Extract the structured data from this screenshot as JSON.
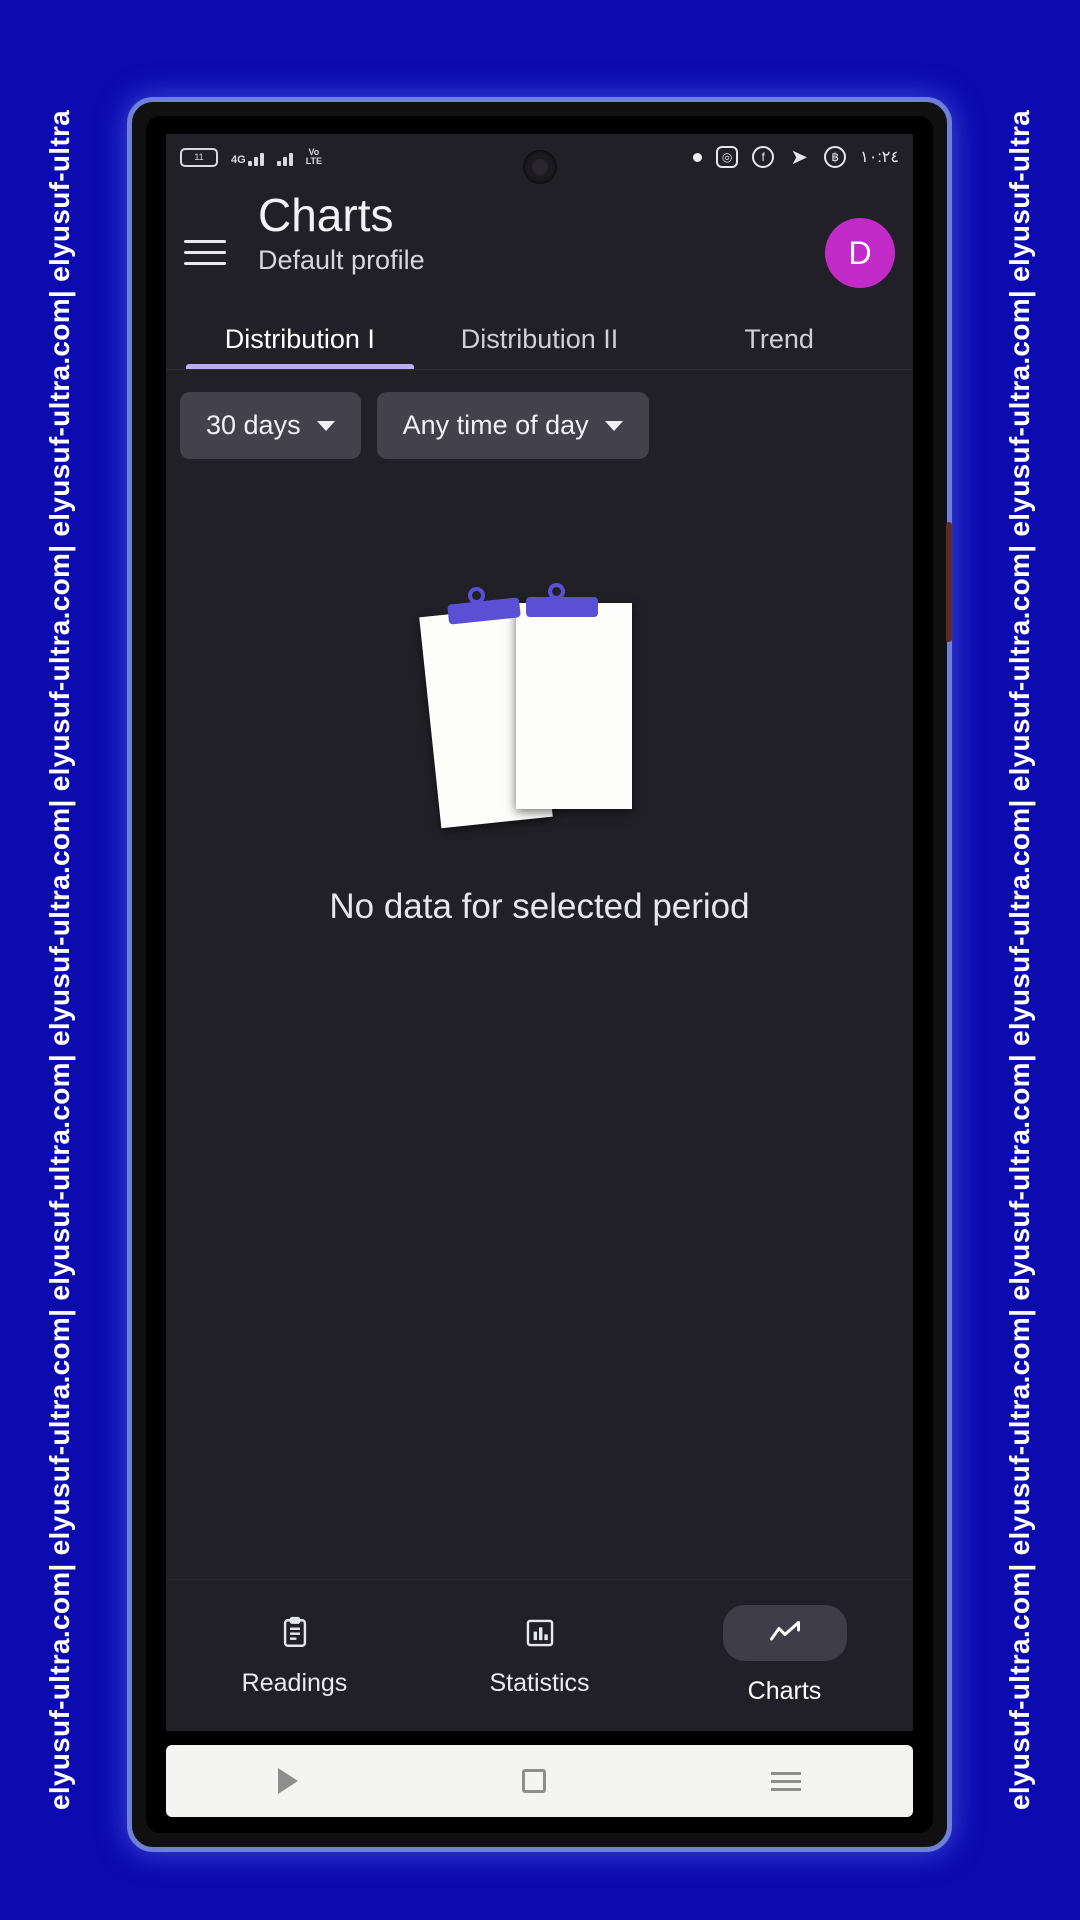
{
  "watermark": {
    "text": "elyusuf-ultra.com| elyusuf-ultra.com| elyusuf-ultra.com| elyusuf-ultra.com| elyusuf-ultra.com| elyusuf-ultra.com| elyusuf-ultra"
  },
  "statusbar": {
    "battery_label": "11",
    "network_label": "4G",
    "volte_top": "Vo",
    "volte_bottom": "LTE",
    "instagram_icon": "instagram-icon",
    "facebook_icon": "facebook-icon",
    "telegram_icon": "telegram-icon",
    "bitcoin_icon": "bitcoin-icon",
    "clock": "١٠:٢٤"
  },
  "appbar": {
    "menu_icon": "hamburger-menu-icon",
    "title": "Charts",
    "subtitle": "Default profile",
    "avatar_initial": "D"
  },
  "tabs": [
    {
      "label": "Distribution I",
      "active": true
    },
    {
      "label": "Distribution II",
      "active": false
    },
    {
      "label": "Trend",
      "active": false
    }
  ],
  "filters": [
    {
      "label": "30 days",
      "icon": "chevron-down-icon"
    },
    {
      "label": "Any time of day",
      "icon": "chevron-down-icon"
    }
  ],
  "empty_state": {
    "illustration": "empty-clipboard-illustration",
    "message": "No data for selected period"
  },
  "bottom_nav": [
    {
      "label": "Readings",
      "icon": "clipboard-icon",
      "active": false
    },
    {
      "label": "Statistics",
      "icon": "bar-chart-icon",
      "active": false
    },
    {
      "label": "Charts",
      "icon": "trend-line-icon",
      "active": true
    }
  ],
  "android_nav": {
    "back": "back-triangle-icon",
    "home": "home-square-icon",
    "recents": "recents-lines-icon"
  },
  "colors": {
    "page_background": "#0b0bb0",
    "app_surface": "#212026",
    "accent": "#b9aef5",
    "avatar": "#c22bc7",
    "chip": "#43414c",
    "clip": "#5b4fd6"
  }
}
